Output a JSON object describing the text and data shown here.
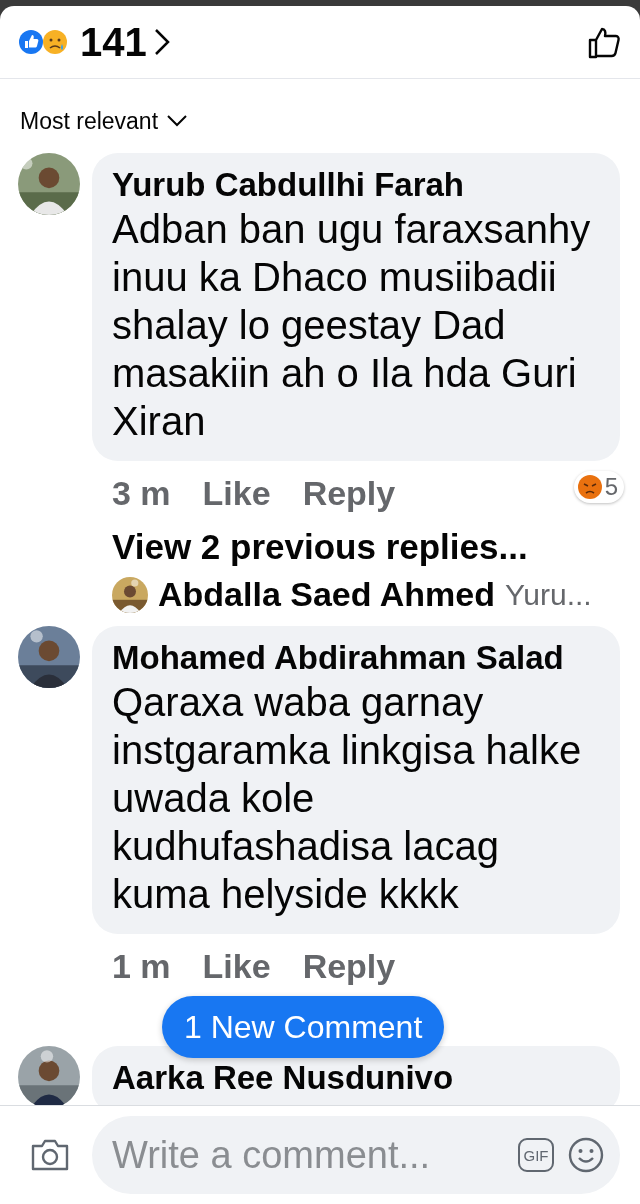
{
  "header": {
    "reaction_count": "141"
  },
  "sort": {
    "label": "Most relevant"
  },
  "comments": [
    {
      "author": "Yurub Cabdullhi Farah",
      "text": "Adban ban ugu faraxsanhy inuu ka Dhaco musiibadii shalay lo geestay Dad masakiin ah o Ila hda Guri Xiran",
      "time": "3 m",
      "actions": [
        "Like",
        "Reply"
      ],
      "reaction_count": "5",
      "view_replies": "View 2 previous replies...",
      "reply_preview": {
        "author": "Abdalla Saed Ahmed",
        "text": "Yuru..."
      }
    },
    {
      "author": "Mohamed Abdirahman Salad",
      "text": "Qaraxa waba garnay instgaramka linkgisa halke uwada kole kudhufashadisa lacag kuma helyside kkkk",
      "time": "1 m",
      "actions": [
        "Like",
        "Reply"
      ]
    },
    {
      "author": "Aarka Ree Nusdunivo"
    }
  ],
  "new_comment_pill": "1 New Comment",
  "composer": {
    "placeholder": "Write a comment...",
    "gif_label": "GIF"
  }
}
